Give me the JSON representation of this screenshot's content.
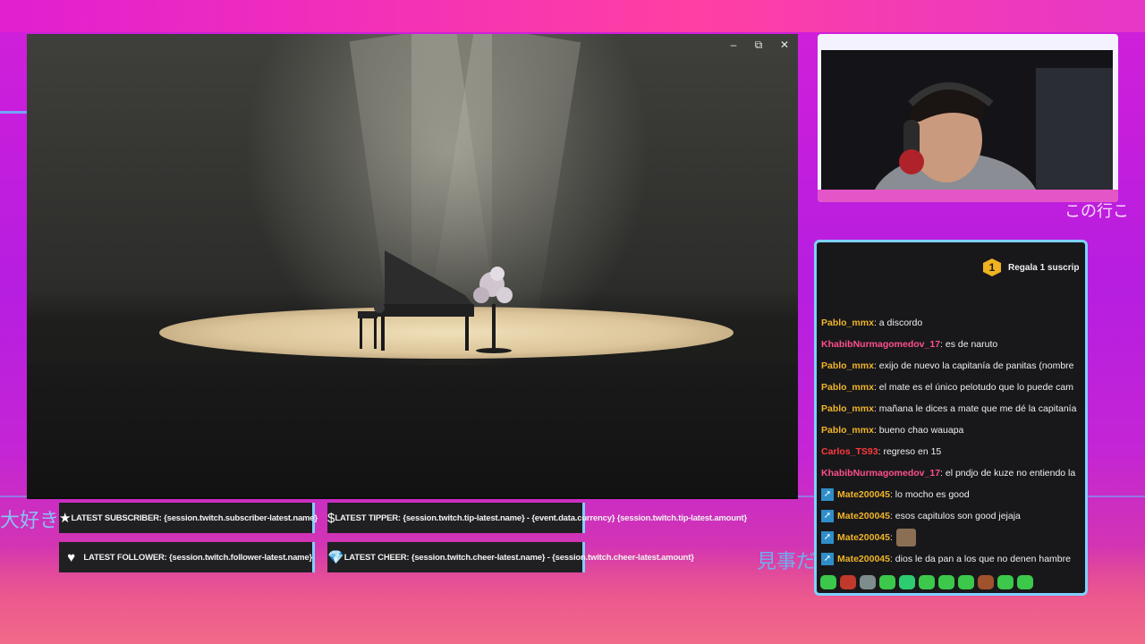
{
  "window_controls": {
    "minimize": "–",
    "maximize": "⧉",
    "close": "✕"
  },
  "alerts": {
    "subscriber": {
      "icon": "★",
      "text": "LATEST SUBSCRIBER: {session.twitch.subscriber-latest.name}"
    },
    "tipper": {
      "icon": "$",
      "text": "LATEST TIPPER: {session.twitch.tip-latest.name} - {event.data.currency} {session.twitch.tip-latest.amount}"
    },
    "follower": {
      "icon": "♥",
      "text": "LATEST FOLLOWER: {session.twitch.follower-latest.name}"
    },
    "cheer": {
      "icon": "💎",
      "text": "LATEST CHEER: {session.twitch.cheer-latest.name} - {session.twitch.cheer-latest.amount}"
    }
  },
  "chat": {
    "gift": {
      "count": "1",
      "text": "Regala 1 suscrip"
    },
    "messages": [
      {
        "user": "Pablo_mmx",
        "color": "#f0b429",
        "text": ": a discordo",
        "prime": false
      },
      {
        "user": "KhabibNurmagomedov_17",
        "color": "#ff4f8b",
        "text": ": es de naruto",
        "prime": false
      },
      {
        "user": "Pablo_mmx",
        "color": "#f0b429",
        "text": ": exijo de nuevo la capitanía de panitas (nombre",
        "prime": false
      },
      {
        "user": "Pablo_mmx",
        "color": "#f0b429",
        "text": ": el mate es el único pelotudo que lo puede cam",
        "prime": false
      },
      {
        "user": "Pablo_mmx",
        "color": "#f0b429",
        "text": ": mañana le dices a mate que me dé la capitanía",
        "prime": false
      },
      {
        "user": "Pablo_mmx",
        "color": "#f0b429",
        "text": ": bueno chao wauapa",
        "prime": false
      },
      {
        "user": "Carlos_TS93",
        "color": "#ff3b3b",
        "text": ": regreso en 15",
        "prime": false
      },
      {
        "user": "KhabibNurmagomedov_17",
        "color": "#ff4f8b",
        "text": ": el pndjo de kuze no entiendo la",
        "prime": false
      },
      {
        "user": "Mate200045",
        "color": "#f0b429",
        "text": ": lo mocho es good",
        "prime": true
      },
      {
        "user": "Mate200045",
        "color": "#f0b429",
        "text": ": esos capitulos son good jejaja",
        "prime": true
      },
      {
        "user": "Mate200045",
        "color": "#f0b429",
        "text": ":",
        "prime": true,
        "emote": true
      },
      {
        "user": "Mate200045",
        "color": "#f0b429",
        "text": ": dios le da pan a los que no denen hambre",
        "prime": true
      }
    ],
    "emotes": [
      "#3cc84a",
      "#c0392b",
      "#7f8c8d",
      "#3cc84a",
      "#2ecc71",
      "#3cc84a",
      "#3cc84a",
      "#3cc84a",
      "#a0522d",
      "#3cc84a",
      "#3cc84a"
    ]
  },
  "background_text": {
    "left": "大好き",
    "bottom_right": "見事だ",
    "right": "この行こ"
  }
}
